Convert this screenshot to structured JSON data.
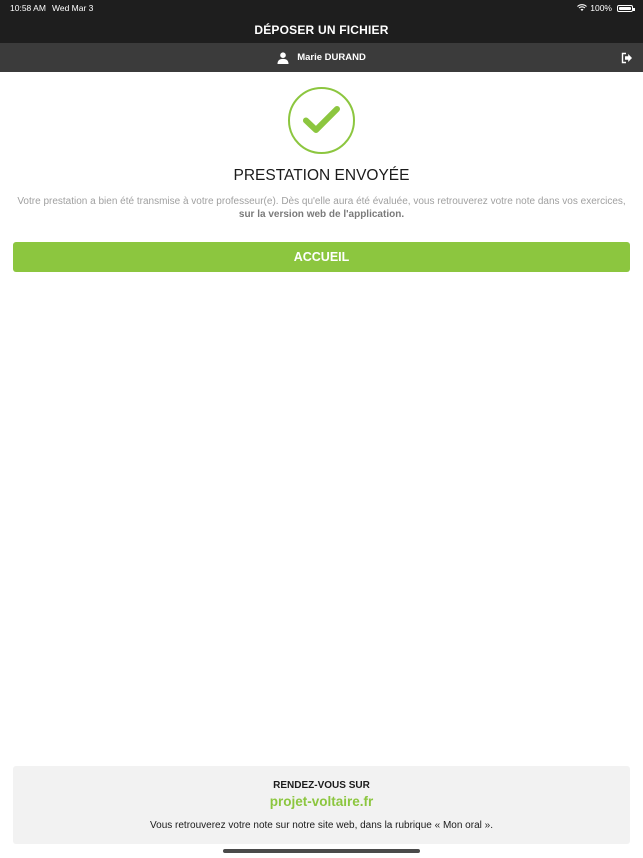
{
  "status_bar": {
    "time": "10:58 AM",
    "date": "Wed Mar 3",
    "battery": "100%",
    "icons": [
      "wifi-icon",
      "battery-icon"
    ]
  },
  "header": {
    "title": "DÉPOSER UN FICHIER"
  },
  "user_bar": {
    "user_name": "Marie DURAND",
    "icons": [
      "user-icon",
      "logout-icon"
    ]
  },
  "main": {
    "icon": "checkmark-circle-icon",
    "heading": "PRESTATION ENVOYÉE",
    "message": "Votre prestation a bien été transmise à votre professeur(e). Dès qu'elle aura été évaluée, vous retrouverez votre note dans vos exercices,",
    "message_bold": "sur la version web de l'application.",
    "button_label": "ACCUEIL"
  },
  "footer": {
    "title": "RENDEZ-VOUS SUR",
    "link": "projet-voltaire.fr",
    "note": "Vous retrouverez votre note sur notre site web, dans la rubrique « Mon oral »."
  },
  "colors": {
    "accent": "#8cc63f",
    "header_bg": "#1e1e1e",
    "user_bar_bg": "#3b3b3b",
    "footer_bg": "#f2f2f2"
  }
}
